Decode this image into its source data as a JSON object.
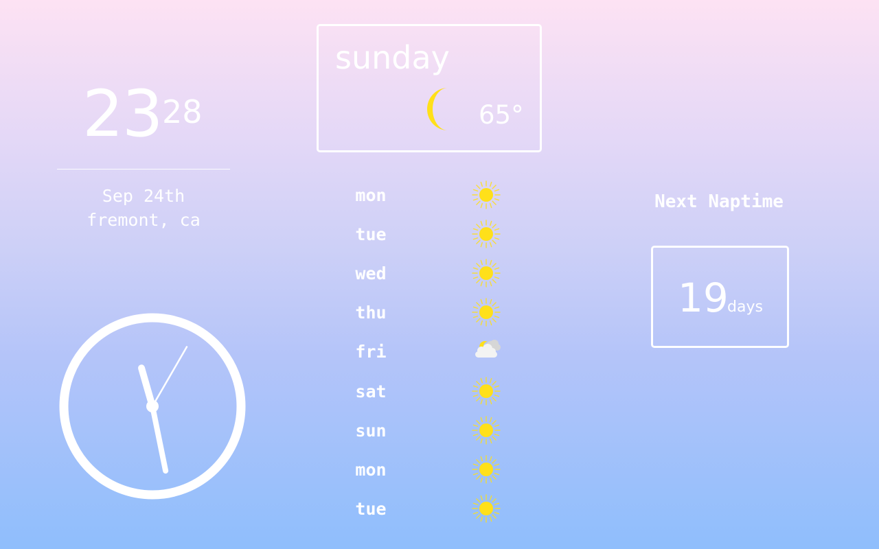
{
  "time": {
    "hours": "23",
    "minutes": "28"
  },
  "date": "Sep 24th",
  "location": "fremont, ca",
  "analog_clock": {
    "hour": 11,
    "minute": 28,
    "second": 5
  },
  "current_weather": {
    "day": "sunday",
    "temperature": "65°",
    "icon": "moon-icon",
    "icon_color": "#ffe01a"
  },
  "forecast": [
    {
      "day": "mon",
      "icon": "sun-icon"
    },
    {
      "day": "tue",
      "icon": "sun-icon"
    },
    {
      "day": "wed",
      "icon": "sun-icon"
    },
    {
      "day": "thu",
      "icon": "sun-icon"
    },
    {
      "day": "fri",
      "icon": "partly-cloudy-night-icon"
    },
    {
      "day": "sat",
      "icon": "sun-icon"
    },
    {
      "day": "sun",
      "icon": "sun-icon"
    },
    {
      "day": "mon",
      "icon": "sun-icon"
    },
    {
      "day": "tue",
      "icon": "sun-icon"
    }
  ],
  "naptime": {
    "label": "Next Naptime",
    "value": "19",
    "unit": "days"
  },
  "colors": {
    "text": "#ffffff",
    "sun": "#ffe01a",
    "cloud": "#f3f3f3"
  }
}
